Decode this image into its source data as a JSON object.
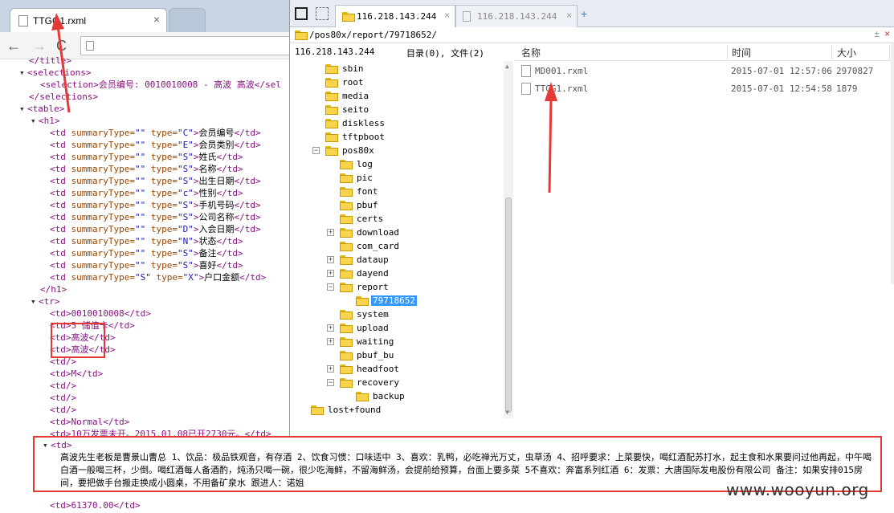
{
  "browser": {
    "tab_title": "TTGG1.rxml",
    "tab_close": "×",
    "nav_back": "←",
    "nav_forward": "→",
    "nav_reload": "C"
  },
  "xml": {
    "title_close": "</title>",
    "selections_open": "<selections>",
    "selection_line": "<selection>会员编号: 0010010008 - 高波 高波</sel",
    "selections_close": "</selections>",
    "table_open": "<table>",
    "h1_open": "<h1>",
    "h1_rows": [
      {
        "type": "C",
        "text": "会员编号"
      },
      {
        "type": "E",
        "text": "会员类别"
      },
      {
        "type": "S",
        "text": "姓氏"
      },
      {
        "type": "S",
        "text": "名称"
      },
      {
        "type": "S",
        "text": "出生日期"
      },
      {
        "type": "c",
        "text": "性别"
      },
      {
        "type": "S",
        "text": "手机号码"
      },
      {
        "type": "S",
        "text": "公司名称"
      },
      {
        "type": "D",
        "text": "入会日期"
      },
      {
        "type": "N",
        "text": "状态"
      },
      {
        "type": "S",
        "text": "备注"
      },
      {
        "type": "S",
        "text": "喜好"
      },
      {
        "type": "X",
        "text": "户口金额",
        "summary": "S"
      }
    ],
    "h1_close": "</h1>",
    "tr_open": "<tr>",
    "tr_rows": [
      "<td>0010010008</td>",
      "<td>5 储值卡</td>",
      "<td>高波</td>",
      "<td>高波</td>",
      "<td/>",
      "<td>M</td>",
      "<td/>",
      "<td/>",
      "<td/>",
      "<td>Normal</td>",
      "<td>10万发票未开。2015.01.08已开2730元。</td>"
    ],
    "td_open": "<td>",
    "long_note": "高波先生老板是曹景山曹总 1、饮品：极品铁观音，有存酒 2、饮食习惯：口味适中 3、喜欢：乳鸭，必吃禅光万丈，虫草汤 4、招呼要求：上菜要快，喝红酒配苏打水，起主食和水果要问过他再起，中午喝白酒一般喝三杯，少倒。喝红酒每人备酒酌，炖汤只喝一碗，很少吃海鲜，不留海鲜汤，会提前给预算，台面上要多菜 5不喜欢：奔富系列红酒 6：发票：大唐国际发电股份有限公司 备注：如果安排015房间，要把做手台搬走换成小圆桌，不用备矿泉水 跟进人：诺姐",
    "last_line": "<td>61370.00</td>"
  },
  "file_manager": {
    "tab1_label": "116.218.143.244",
    "tab2_label": "116.218.143.244",
    "tab_add": "+",
    "tab_close": "×",
    "path": "/pos80x/report/79718652/",
    "path_buttons": "±",
    "path_close": "×",
    "host": "116.218.143.244",
    "count": "目录(0), 文件(2)",
    "columns": {
      "name": "名称",
      "time": "时间",
      "size": "大小"
    },
    "tree": [
      {
        "label": "sbin",
        "depth": 1,
        "exp": ""
      },
      {
        "label": "root",
        "depth": 1,
        "exp": ""
      },
      {
        "label": "media",
        "depth": 1,
        "exp": ""
      },
      {
        "label": "seito",
        "depth": 1,
        "exp": ""
      },
      {
        "label": "diskless",
        "depth": 1,
        "exp": ""
      },
      {
        "label": "tftpboot",
        "depth": 1,
        "exp": ""
      },
      {
        "label": "pos80x",
        "depth": 1,
        "exp": "−"
      },
      {
        "label": "log",
        "depth": 2,
        "exp": ""
      },
      {
        "label": "pic",
        "depth": 2,
        "exp": ""
      },
      {
        "label": "font",
        "depth": 2,
        "exp": ""
      },
      {
        "label": "pbuf",
        "depth": 2,
        "exp": ""
      },
      {
        "label": "certs",
        "depth": 2,
        "exp": ""
      },
      {
        "label": "download",
        "depth": 2,
        "exp": "+"
      },
      {
        "label": "com_card",
        "depth": 2,
        "exp": ""
      },
      {
        "label": "dataup",
        "depth": 2,
        "exp": "+"
      },
      {
        "label": "dayend",
        "depth": 2,
        "exp": "+"
      },
      {
        "label": "report",
        "depth": 2,
        "exp": "−"
      },
      {
        "label": "79718652",
        "depth": 3,
        "exp": "",
        "selected": true
      },
      {
        "label": "system",
        "depth": 2,
        "exp": ""
      },
      {
        "label": "upload",
        "depth": 2,
        "exp": "+"
      },
      {
        "label": "waiting",
        "depth": 2,
        "exp": "+"
      },
      {
        "label": "pbuf_bu",
        "depth": 2,
        "exp": ""
      },
      {
        "label": "headfoot",
        "depth": 2,
        "exp": "+"
      },
      {
        "label": "recovery",
        "depth": 2,
        "exp": "−"
      },
      {
        "label": "backup",
        "depth": 3,
        "exp": ""
      },
      {
        "label": "lost+found",
        "depth": 0,
        "exp": ""
      }
    ],
    "files": [
      {
        "name": "MD001.rxml",
        "time": "2015-07-01 12:57:06",
        "size": "2970827"
      },
      {
        "name": "TTGG1.rxml",
        "time": "2015-07-01 12:54:58",
        "size": "1879"
      }
    ]
  },
  "watermark": "www.wooyun.org",
  "colors": {
    "annotation": "#e53935",
    "selection": "#3399ff",
    "xml_tag": "#881280",
    "xml_value": "#1a1aa6"
  }
}
